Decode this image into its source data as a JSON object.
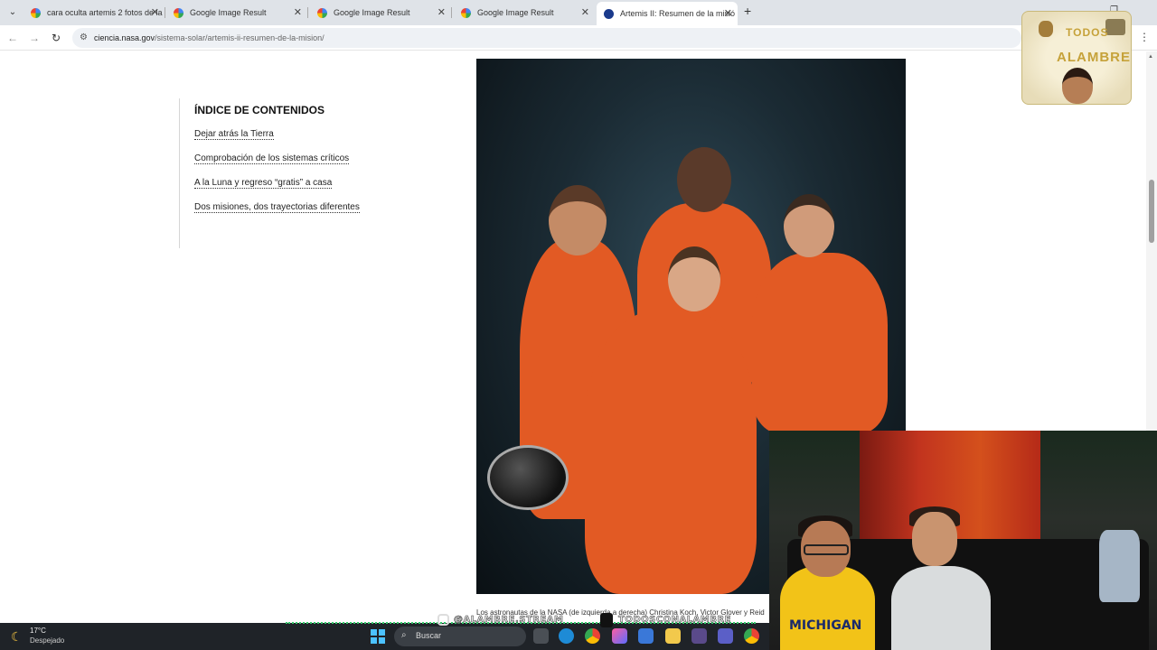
{
  "browser": {
    "tabs": [
      {
        "title": "cara oculta artemis 2 fotos de la",
        "active": false
      },
      {
        "title": "Google Image Result",
        "active": false
      },
      {
        "title": "Google Image Result",
        "active": false
      },
      {
        "title": "Google Image Result",
        "active": false
      },
      {
        "title": "Artemis II: Resumen de la misió",
        "active": true
      }
    ],
    "new_tab": "+",
    "url_host": "ciencia.nasa.gov",
    "url_path": "/sistema-solar/artemis-ii-resumen-de-la-mision/"
  },
  "toc": {
    "heading": "ÍNDICE DE CONTENIDOS",
    "items": [
      "Dejar atrás la Tierra",
      "Comprobación de los sistemas críticos",
      "A la Luna y regreso “gratis” a casa",
      "Dos misiones, dos trayectorias diferentes"
    ]
  },
  "caption": "Los astronautas de la NASA (de izquierda a derecha) Christina Koch, Victor Glover y Reid",
  "logo": {
    "line1": "TODOS",
    "line2": "ALAMBRE"
  },
  "webcam": {
    "shirt_text": "MICHIGAN"
  },
  "stream": {
    "handle1": "@ALAMBRE.STREAM",
    "handle2": "TODOSCONALAMBRE"
  },
  "taskbar": {
    "temperature": "17°C",
    "weather": "Despejado",
    "search_placeholder": "Buscar"
  },
  "colors": {
    "suit": "#e25a24",
    "tab_bar": "#dfe3e8",
    "taskbar": "#1f2328"
  }
}
